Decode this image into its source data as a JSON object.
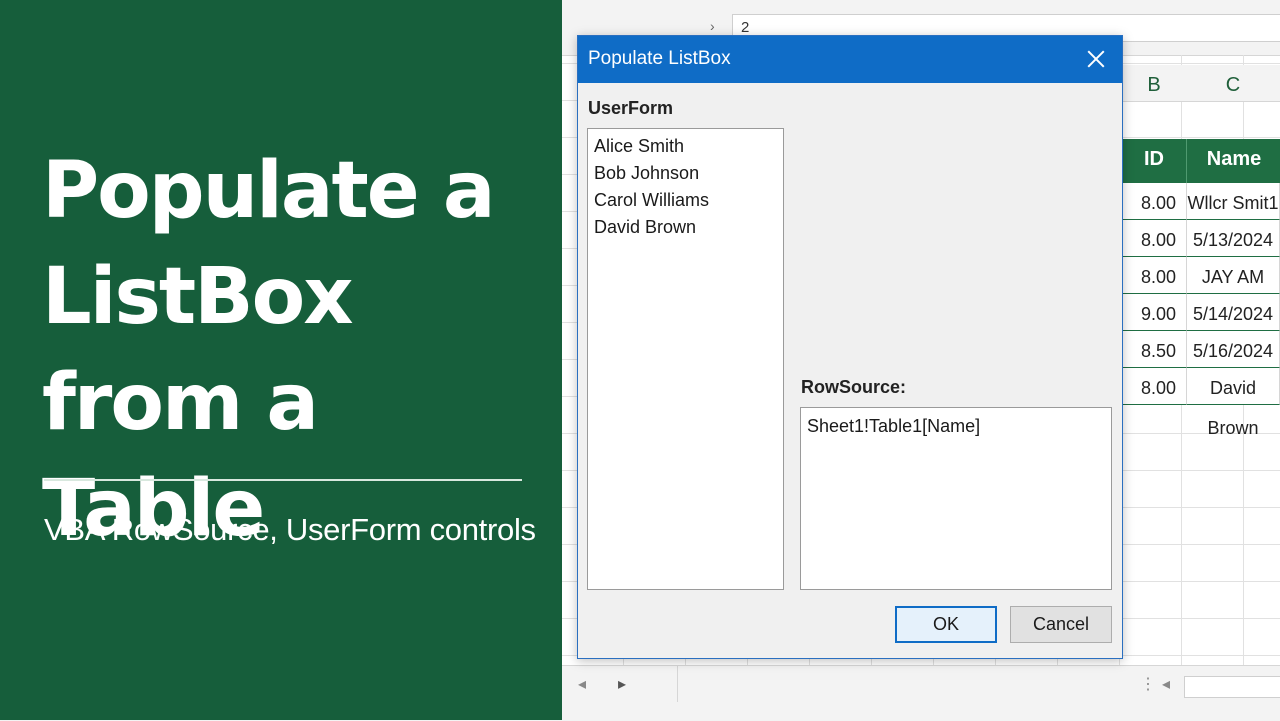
{
  "banner": {
    "title_lines": [
      "Populate a",
      "ListBox from a",
      "Table"
    ],
    "subtitle": "VBA RowSource, UserForm controls",
    "bg_color": "#165e3b"
  },
  "sheet": {
    "formula_value": "2",
    "columns": [
      "B",
      "C"
    ],
    "table_headers": [
      "ID",
      "Name"
    ],
    "rows": [
      {
        "id": "8.00",
        "name": "Wllcr Smit1"
      },
      {
        "id": "8.00",
        "name": "5/13/2024"
      },
      {
        "id": "8.00",
        "name": "JAY AM"
      },
      {
        "id": "9.00",
        "name": "5/14/2024"
      },
      {
        "id": "8.50",
        "name": "5/16/2024"
      },
      {
        "id": "8.00",
        "name": "David Brown"
      }
    ],
    "table_header_color": "#1f6e43"
  },
  "dialog": {
    "title": "Populate ListBox",
    "form_label": "UserForm",
    "list_items": [
      "Alice Smith",
      "Bob Johnson",
      "Carol Williams",
      "David Brown"
    ],
    "rowsource_label": "RowSource:",
    "rowsource_value": "Sheet1!Table1[Name]",
    "ok_label": "OK",
    "cancel_label": "Cancel",
    "title_bar_color": "#0f6cc6",
    "close_icon": "close-icon"
  },
  "status_bar": {
    "prev_icon": "arrow-left-icon",
    "next_icon": "arrow-right-icon"
  }
}
